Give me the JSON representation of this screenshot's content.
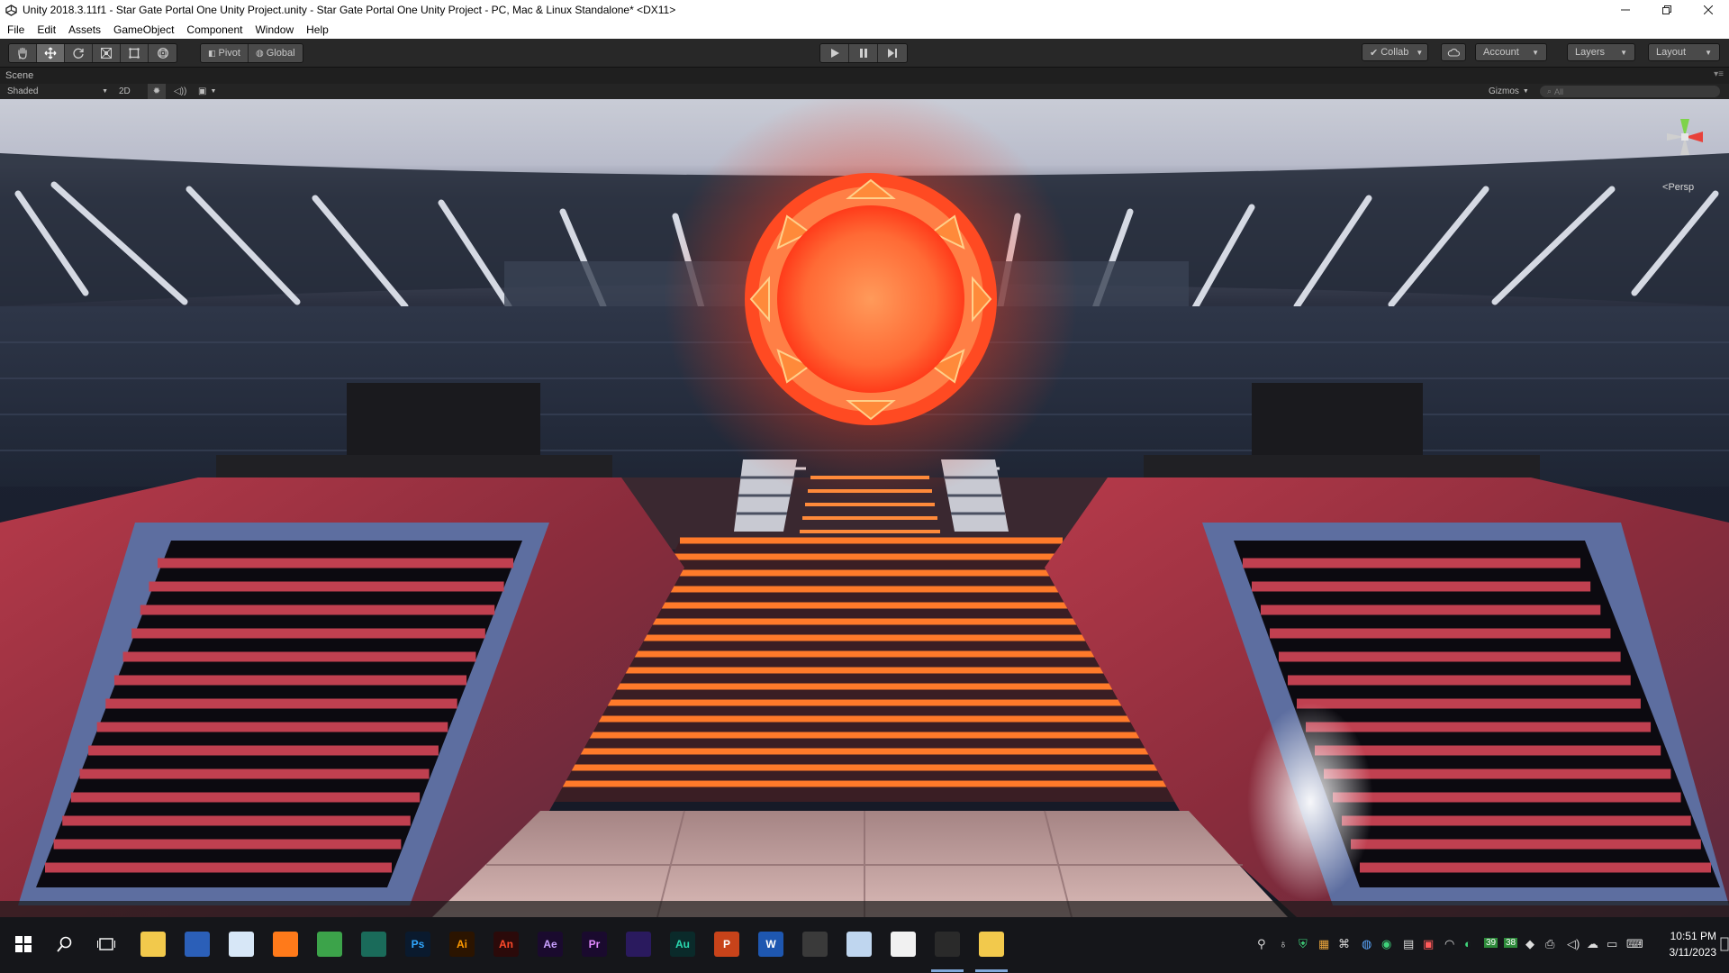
{
  "window": {
    "title": "Unity 2018.3.11f1 - Star Gate Portal One Unity Project.unity - Star Gate Portal One Unity Project - PC, Mac & Linux Standalone* <DX11>"
  },
  "menu": {
    "items": [
      "File",
      "Edit",
      "Assets",
      "GameObject",
      "Component",
      "Window",
      "Help"
    ]
  },
  "toolbar": {
    "transform_tools": [
      "hand-icon",
      "move-icon",
      "rotate-icon",
      "scale-icon",
      "rect-icon",
      "transform-icon"
    ],
    "active_tool": "move-icon",
    "pivot_label": "Pivot",
    "global_label": "Global",
    "collab_label": "Collab",
    "account_label": "Account",
    "layers_label": "Layers",
    "layout_label": "Layout"
  },
  "scene": {
    "tab_label": "Scene",
    "shading_mode": "Shaded",
    "mode_2d_label": "2D",
    "gizmos_label": "Gizmos",
    "search_placeholder": "All",
    "projection_label": "Persp"
  },
  "taskbar": {
    "apps": [
      {
        "name": "file-explorer",
        "label": ""
      },
      {
        "name": "windows-store",
        "label": ""
      },
      {
        "name": "paint-app",
        "label": ""
      },
      {
        "name": "firefox",
        "label": ""
      },
      {
        "name": "chrome",
        "label": ""
      },
      {
        "name": "sourcetree",
        "label": ""
      },
      {
        "name": "photoshop",
        "label": "Ps"
      },
      {
        "name": "illustrator",
        "label": "Ai"
      },
      {
        "name": "animate",
        "label": "An"
      },
      {
        "name": "after-effects",
        "label": "Ae"
      },
      {
        "name": "premiere-pro",
        "label": "Pr"
      },
      {
        "name": "visual-studio",
        "label": ""
      },
      {
        "name": "audition",
        "label": "Au"
      },
      {
        "name": "powerpoint",
        "label": "P"
      },
      {
        "name": "word",
        "label": "W"
      },
      {
        "name": "sublime-text",
        "label": ""
      },
      {
        "name": "notepad",
        "label": ""
      },
      {
        "name": "windows-app",
        "label": ""
      },
      {
        "name": "unity",
        "label": ""
      },
      {
        "name": "explorer-folder",
        "label": ""
      }
    ],
    "tray_badges": [
      "39",
      "38"
    ],
    "time": "10:51 PM",
    "date": "3/11/2023"
  },
  "colors": {
    "unity_toolbar": "#282828",
    "portal_glow": "#ff5a2a",
    "stair_glow": "#ff7a2a",
    "taskbar": "#15161a"
  }
}
